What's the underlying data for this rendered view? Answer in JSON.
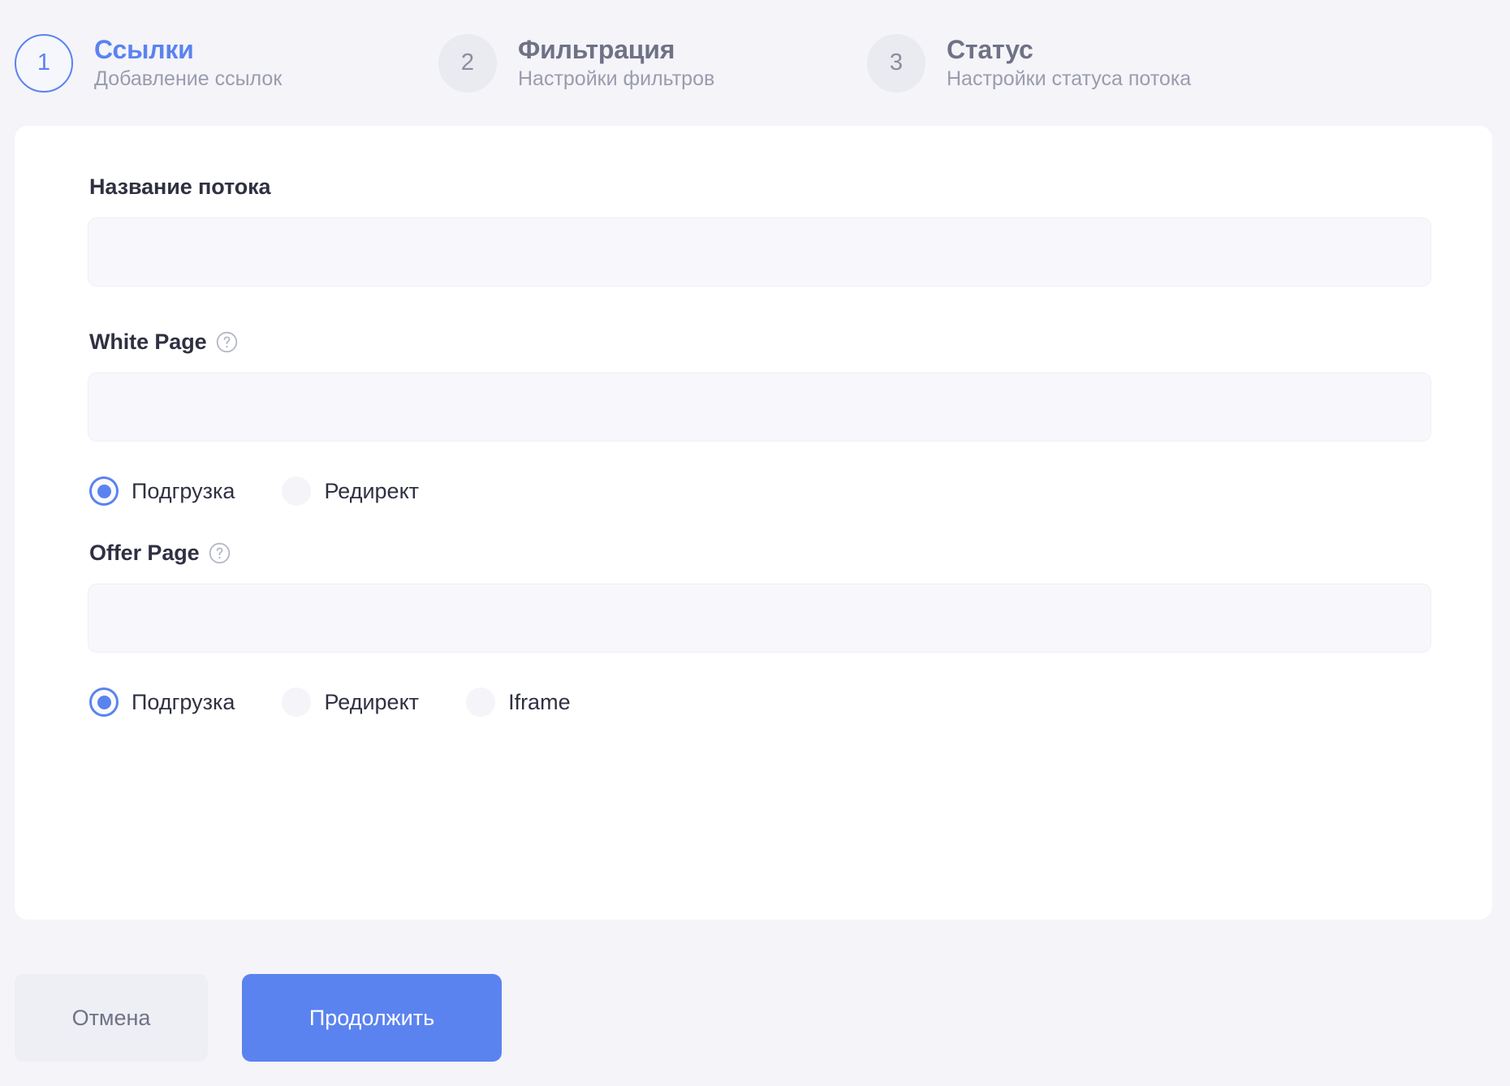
{
  "stepper": {
    "steps": [
      {
        "number": "1",
        "title": "Ссылки",
        "subtitle": "Добавление ссылок",
        "state": "active"
      },
      {
        "number": "2",
        "title": "Фильтрация",
        "subtitle": "Настройки фильтров",
        "state": "inactive"
      },
      {
        "number": "3",
        "title": "Статус",
        "subtitle": "Настройки статуса потока",
        "state": "inactive"
      }
    ]
  },
  "form": {
    "flow_name": {
      "label": "Название потока",
      "value": "",
      "placeholder": ""
    },
    "white_page": {
      "label": "White Page",
      "help_icon": "question-circle-icon",
      "value": "",
      "placeholder": "",
      "mode_options": [
        {
          "label": "Подгрузка",
          "selected": true
        },
        {
          "label": "Редирект",
          "selected": false
        }
      ]
    },
    "offer_page": {
      "label": "Offer Page",
      "help_icon": "question-circle-icon",
      "value": "",
      "placeholder": "",
      "mode_options": [
        {
          "label": "Подгрузка",
          "selected": true
        },
        {
          "label": "Редирект",
          "selected": false
        },
        {
          "label": "Iframe",
          "selected": false
        }
      ]
    }
  },
  "footer": {
    "cancel_label": "Отмена",
    "continue_label": "Продолжить"
  },
  "colors": {
    "accent": "#5b83ef",
    "page_background": "#f4f4f9",
    "card_background": "#ffffff",
    "input_background": "#f8f8fc",
    "text_primary": "#2f3142",
    "text_muted": "#9a9cae"
  }
}
